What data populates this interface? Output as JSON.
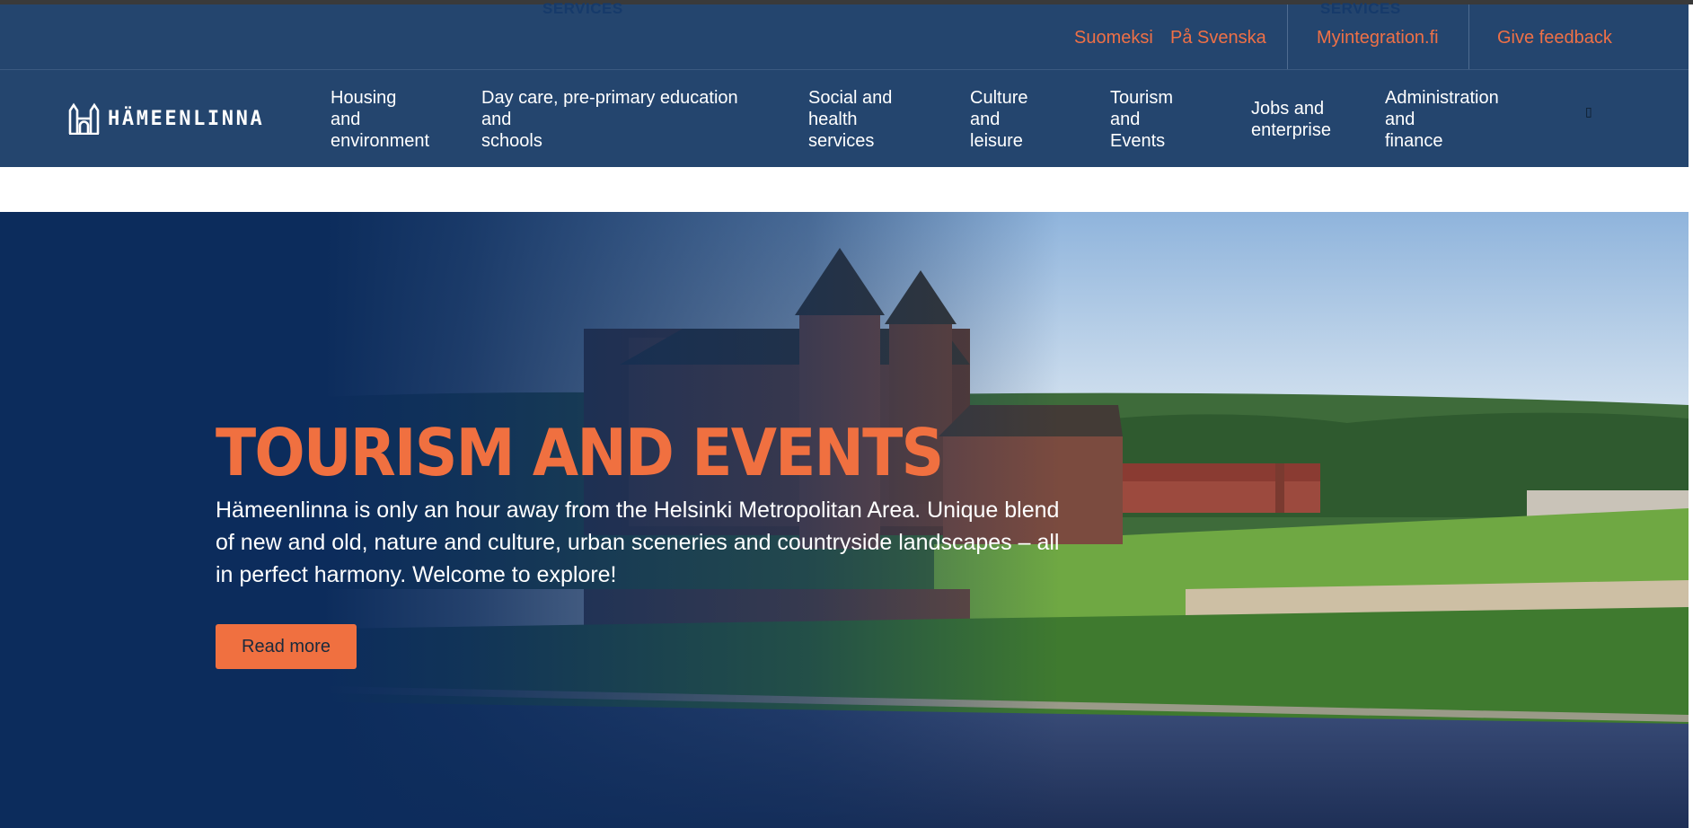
{
  "utility": {
    "ghost_label_left": "SERVICES",
    "ghost_label_right": "SERVICES",
    "lang_fi": "Suomeksi",
    "lang_sv": "På Svenska",
    "myintegration": "Myintegration.fi",
    "feedback": "Give feedback"
  },
  "logo": {
    "text": "HÄMEENLINNA"
  },
  "nav": {
    "items": [
      {
        "label": "Housing\nand\nenvironment"
      },
      {
        "label": "Day care, pre-primary education\nand\nschools"
      },
      {
        "label": "Social and\nhealth\nservices"
      },
      {
        "label": "Culture\nand\nleisure"
      },
      {
        "label": "Tourism\nand\nEvents"
      },
      {
        "label": "Jobs and\nenterprise"
      },
      {
        "label": "Administration\nand\nfinance"
      }
    ],
    "search_icon": "search-icon"
  },
  "hero": {
    "title": "TOURISM AND EVENTS",
    "text": "Hämeenlinna is only an hour away from the Helsinki Metropolitan Area. Unique blend of new and old, nature and culture, urban sceneries and countryside landscapes – all in per­fect harmony. Welcome to explore!",
    "button": "Read more"
  },
  "colors": {
    "header_bg": "#24456e",
    "accent": "#f07040",
    "hero_overlay": "#0c2c5c"
  }
}
